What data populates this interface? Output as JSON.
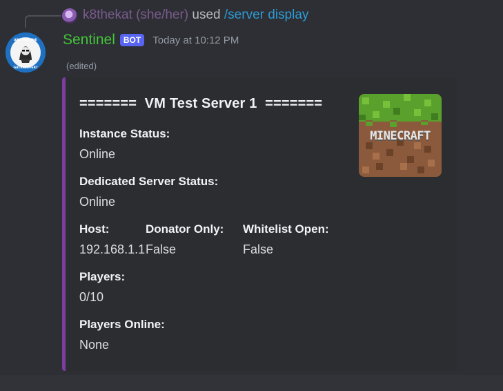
{
  "command": {
    "user": "k8thekat (she/her)",
    "verb": "used",
    "name": "/server display"
  },
  "message": {
    "author": "Sentinel",
    "bot_tag": "BOT",
    "timestamp": "Today at 10:12 PM",
    "edited": "(edited)",
    "avatar_text": [
      "ARE YOU THE",
      "GATEKEEPER?"
    ]
  },
  "embed": {
    "title": "=======  VM Test Server 1  =======",
    "accent_color": "#7c3ca0",
    "thumbnail_text": "MINECRAFT",
    "fields": {
      "instance_status": {
        "name": "Instance Status:",
        "value": "Online"
      },
      "dedicated_status": {
        "name": "Dedicated Server Status:",
        "value": "Online"
      },
      "host": {
        "name": "Host:",
        "value": "192.168.1.1"
      },
      "donator_only": {
        "name": "Donator Only:",
        "value": "False"
      },
      "whitelist_open": {
        "name": "Whitelist Open:",
        "value": "False"
      },
      "players": {
        "name": "Players:",
        "value": "0/10"
      },
      "players_online": {
        "name": "Players Online:",
        "value": "None"
      }
    }
  }
}
